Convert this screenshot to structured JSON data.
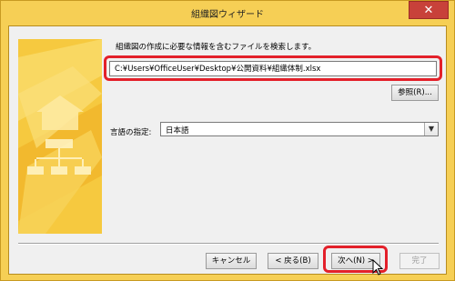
{
  "window": {
    "title": "組織図ウィザード",
    "close_icon": "close-icon",
    "accent_color": "#f6cf55"
  },
  "wizard": {
    "instruction": "組織図の作成に必要な情報を含むファイルを検索します。",
    "file_path": "C:¥Users¥OfficeUser¥Desktop¥公開資料¥組織体制.xlsx",
    "browse_label": "参照(R)...",
    "language_label": "言語の指定:",
    "language_value": "日本語",
    "highlight_color": "#e3202a"
  },
  "footer": {
    "cancel_label": "キャンセル",
    "back_label": "< 戻る(B)",
    "next_label": "次へ(N) >",
    "finish_label": "完了"
  }
}
